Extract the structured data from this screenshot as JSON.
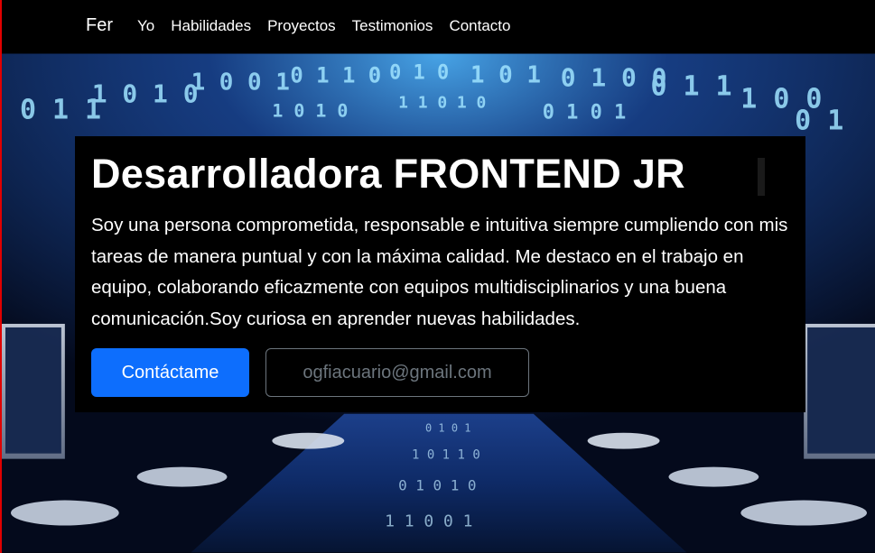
{
  "navbar": {
    "brand": "Fer",
    "links": [
      {
        "label": "Yo"
      },
      {
        "label": "Habilidades"
      },
      {
        "label": "Proyectos"
      },
      {
        "label": "Testimonios"
      },
      {
        "label": "Contacto"
      }
    ]
  },
  "hero": {
    "title": "Desarrolladora FRONTEND JR",
    "description": "Soy una persona comprometida, responsable e intuitiva siempre cumpliendo con mis tareas de manera puntual y con la máxima calidad. Me destaco en el trabajo en equipo, colaborando eficazmente con equipos multidisciplinarios y una buena comunicación.Soy curiosa en aprender nuevas habilidades.",
    "contact_button": "Contáctame",
    "email_button": "ogfiacuario@gmail.com"
  },
  "colors": {
    "accent": "#0d6efd",
    "navbar_bg": "#000000",
    "card_bg": "#000000",
    "left_border": "#e00000",
    "email_border": "#6c757d"
  }
}
